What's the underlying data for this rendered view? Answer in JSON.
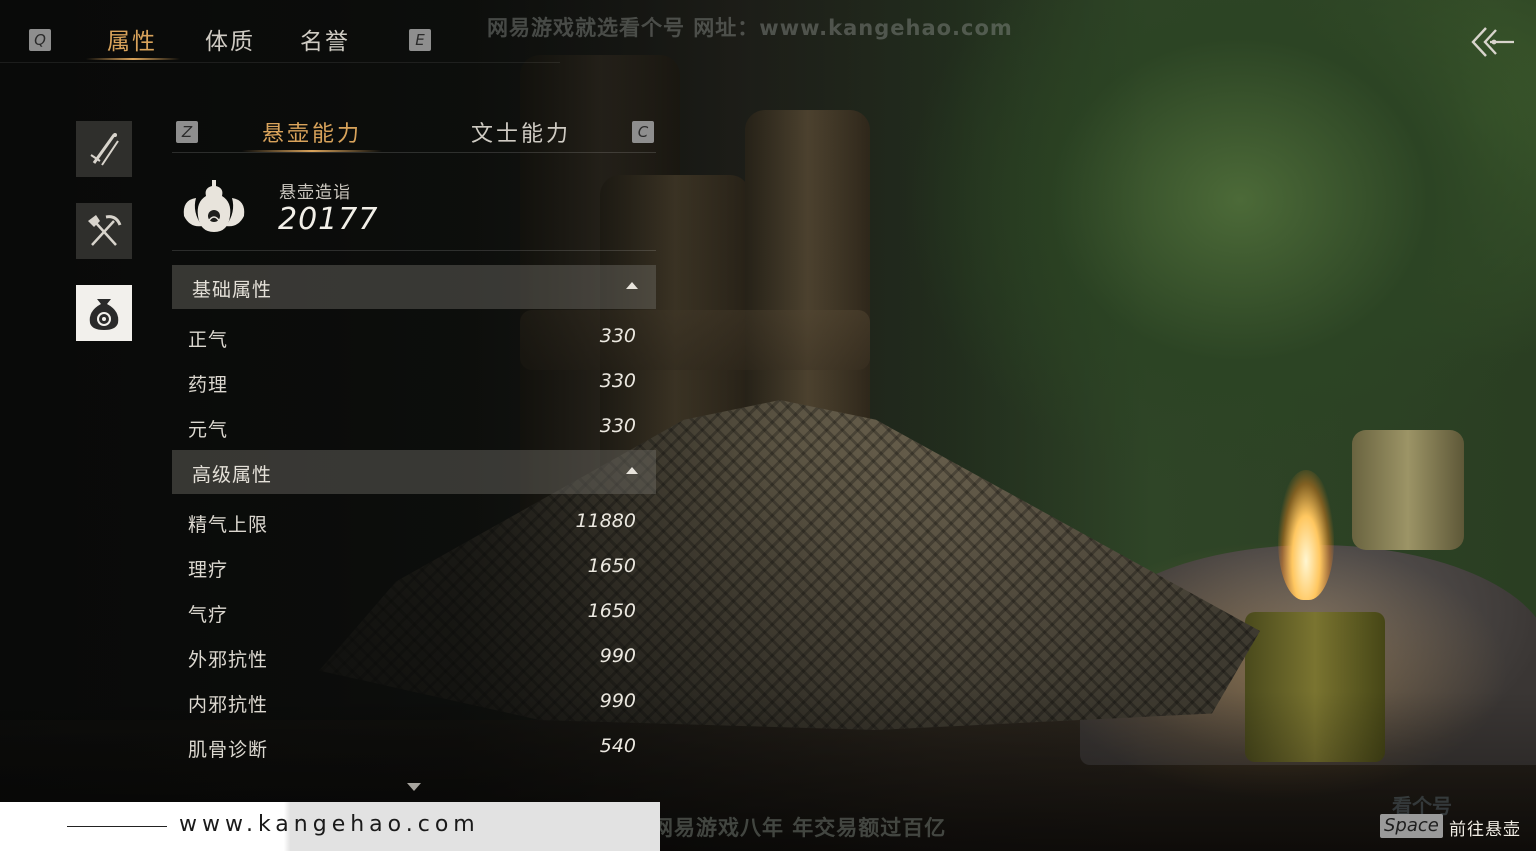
{
  "watermark": {
    "top": "网易游戏就选看个号   网址：www.kangehao.com",
    "bottom": "看个号专业网易游戏八年   年交易额过百亿",
    "logo": "看个号"
  },
  "top_tabs": {
    "prev_key": "Q",
    "next_key": "E",
    "items": [
      {
        "label": "属性",
        "active": true
      },
      {
        "label": "体质",
        "active": false
      },
      {
        "label": "名誉",
        "active": false
      }
    ]
  },
  "side_icons": [
    "sword-brush-icon",
    "shovel-pickaxe-icon",
    "pouch-icon"
  ],
  "sub_tabs": {
    "prev_key": "Z",
    "next_key": "C",
    "items": [
      {
        "label": "悬壶能力",
        "active": true
      },
      {
        "label": "文士能力",
        "active": false
      }
    ]
  },
  "summary": {
    "icon": "gourd-icon",
    "label": "悬壶造诣",
    "value": "20177"
  },
  "sections": {
    "basic": {
      "title": "基础属性",
      "rows": [
        {
          "name": "正气",
          "value": "330"
        },
        {
          "name": "药理",
          "value": "330"
        },
        {
          "name": "元气",
          "value": "330"
        }
      ]
    },
    "advanced": {
      "title": "高级属性",
      "rows": [
        {
          "name": "精气上限",
          "value": "11880"
        },
        {
          "name": "理疗",
          "value": "1650"
        },
        {
          "name": "气疗",
          "value": "1650"
        },
        {
          "name": "外邪抗性",
          "value": "990"
        },
        {
          "name": "内邪抗性",
          "value": "990"
        },
        {
          "name": "肌骨诊断",
          "value": "540"
        }
      ]
    }
  },
  "footer": {
    "url": "www.kangehao.com",
    "space_key": "Space",
    "space_action": "前往悬壶"
  },
  "colors": {
    "accent": "#d9a35b",
    "text": "#d8d4cc"
  }
}
